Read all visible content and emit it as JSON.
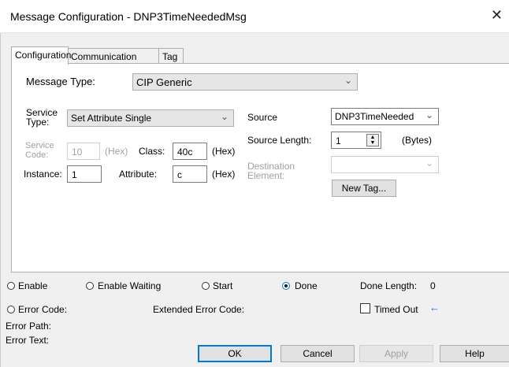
{
  "window": {
    "title": "Message Configuration - DNP3TimeNeededMsg",
    "close_glyph": "✕"
  },
  "tabs": [
    "Configuration",
    "Communication",
    "Tag"
  ],
  "config": {
    "message_type_label": "Message Type:",
    "message_type_value": "CIP Generic",
    "service_type_label": "Service Type:",
    "service_type_value": "Set Attribute Single",
    "service_code_label": "Service Code:",
    "service_code_value": "10",
    "hex": "(Hex)",
    "class_label": "Class:",
    "class_value": "40c",
    "instance_label": "Instance:",
    "instance_value": "1",
    "attribute_label": "Attribute:",
    "attribute_value": "c",
    "source_label": "Source",
    "source_value": "DNP3TimeNeeded",
    "source_length_label": "Source Length:",
    "source_length_value": "1",
    "bytes": "(Bytes)",
    "destination_label": "Destination Element:",
    "destination_value": "",
    "new_tag_label": "New Tag..."
  },
  "status": {
    "enable": "Enable",
    "enable_waiting": "Enable Waiting",
    "start": "Start",
    "done": "Done",
    "done_length_label": "Done Length:",
    "done_length_value": "0",
    "error_code": "Error Code:",
    "extended_error_code": "Extended Error Code:",
    "timed_out": "Timed Out",
    "timed_out_arrow": "←",
    "error_path": "Error Path:",
    "error_text": "Error Text:"
  },
  "buttons": {
    "ok": "OK",
    "cancel": "Cancel",
    "apply": "Apply",
    "help": "Help"
  },
  "colors": {
    "accent": "#0078d7",
    "face": "#f0f0f0",
    "arrow": "#1e64c8"
  }
}
